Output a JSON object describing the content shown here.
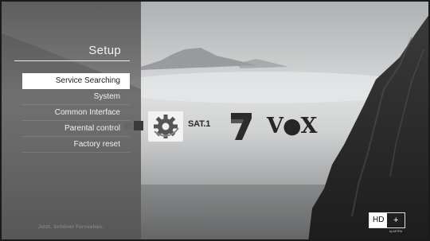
{
  "menu": {
    "title": "Setup",
    "items": [
      {
        "label": "Service Searching",
        "selected": true
      },
      {
        "label": "System",
        "selected": false
      },
      {
        "label": "Common Interface",
        "selected": false
      },
      {
        "label": "Parental control",
        "selected": false
      },
      {
        "label": "Factory reset",
        "selected": false
      }
    ]
  },
  "footer": {
    "tagline": "Jetzt. Schöner Fernsehen."
  },
  "channels": {
    "sat1": "SAT.1",
    "vox": "V●X",
    "gear_icon": "gear-icon",
    "pro7_icon": "pro7-logo-icon"
  },
  "badge": {
    "hd": "HD",
    "plus": "+",
    "sub": "by ASTRA"
  },
  "colors": {
    "sidebar": "#5a5a5a",
    "selected_bg": "#ffffff",
    "text": "#f1f1f1"
  }
}
